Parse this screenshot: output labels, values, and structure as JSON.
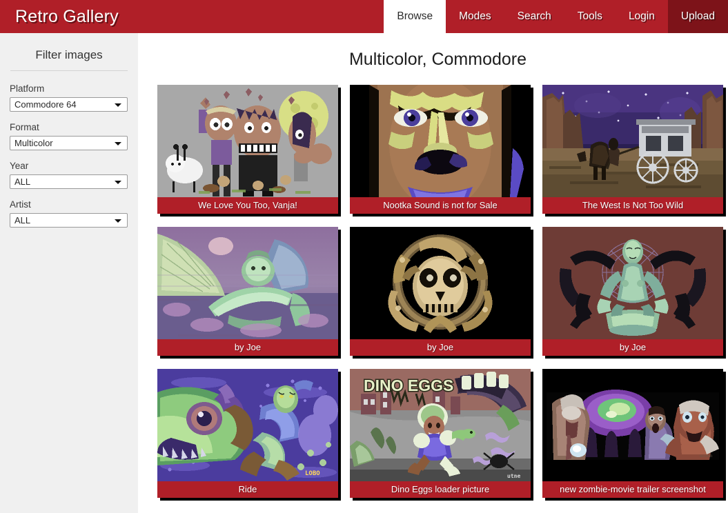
{
  "header": {
    "brand": "Retro Gallery",
    "brand_color": "#b01f28",
    "accent_color": "#7d1319",
    "nav": [
      {
        "label": "Browse",
        "state": "active"
      },
      {
        "label": "Modes",
        "state": "normal"
      },
      {
        "label": "Search",
        "state": "normal"
      },
      {
        "label": "Tools",
        "state": "normal"
      },
      {
        "label": "Login",
        "state": "normal"
      },
      {
        "label": "Upload",
        "state": "accent"
      }
    ]
  },
  "sidebar": {
    "title": "Filter images",
    "background": "#f0f0f0",
    "filters": [
      {
        "label": "Platform",
        "value": "Commodore 64",
        "icon": "chevron-down-icon"
      },
      {
        "label": "Format",
        "value": "Multicolor",
        "icon": "chevron-down-icon"
      },
      {
        "label": "Year",
        "value": "ALL",
        "icon": "chevron-down-icon"
      },
      {
        "label": "Artist",
        "value": "ALL",
        "icon": "chevron-down-icon"
      }
    ]
  },
  "main": {
    "title": "Multicolor, Commodore",
    "caption_color": "#b01f28",
    "gallery": [
      {
        "caption": "We Love You Too, Vanja!",
        "art": "vanja"
      },
      {
        "caption": "Nootka Sound is not for Sale",
        "art": "nootka"
      },
      {
        "caption": "The West Is Not Too Wild",
        "art": "west"
      },
      {
        "caption": "by Joe",
        "art": "joe1"
      },
      {
        "caption": "by Joe",
        "art": "joe2"
      },
      {
        "caption": "by Joe",
        "art": "joe3"
      },
      {
        "caption": "Ride",
        "art": "ride"
      },
      {
        "caption": "Dino Eggs loader picture",
        "art": "dino"
      },
      {
        "caption": "new zombie-movie trailer screenshot",
        "art": "zombie"
      }
    ]
  }
}
